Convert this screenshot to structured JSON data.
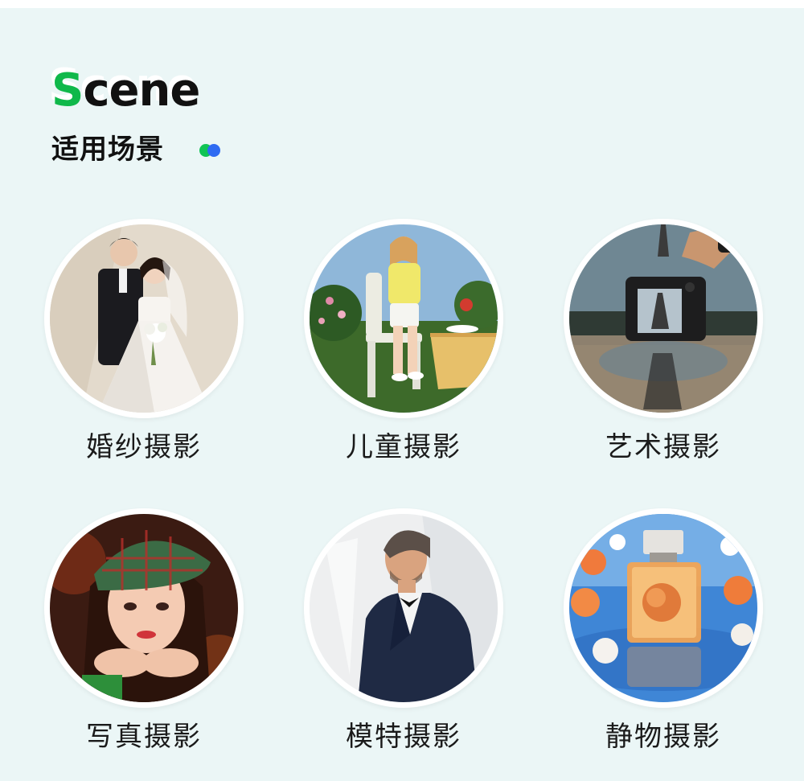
{
  "heading": {
    "english": "Scene",
    "english_first_letter": "S",
    "english_rest": "cene",
    "chinese": "适用场景"
  },
  "colors": {
    "background": "#ebf6f6",
    "accent_green": "#10c455",
    "accent_blue": "#2f6bf2",
    "text": "#111111"
  },
  "scenes": [
    {
      "label": "婚纱摄影",
      "icon": "wedding-photo"
    },
    {
      "label": "儿童摄影",
      "icon": "children-photo"
    },
    {
      "label": "艺术摄影",
      "icon": "art-photo"
    },
    {
      "label": "写真摄影",
      "icon": "portrait-photo"
    },
    {
      "label": "模特摄影",
      "icon": "model-photo"
    },
    {
      "label": "静物摄影",
      "icon": "still-life-photo"
    }
  ]
}
